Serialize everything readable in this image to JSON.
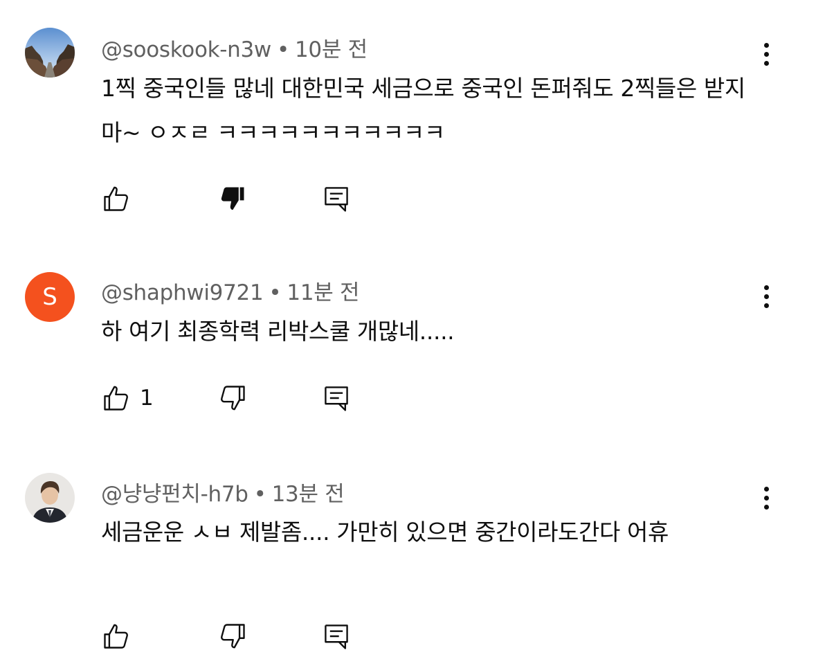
{
  "comments": [
    {
      "author": "@sooskook-n3w",
      "time": "10분 전",
      "text": "1찍 중국인들 많네 대한민국 세금으로 중국인 돈퍼줘도 2찍들은 받지마~ ㅇㅈㄹ ㅋㅋㅋㅋㅋㅋㅋㅋㅋㅋㅋ",
      "like_count": "",
      "disliked": true,
      "avatar_icon": "landscape-photo-avatar"
    },
    {
      "author": "@shaphwi9721",
      "time": "11분 전",
      "text": "하 여기 최종학력 리박스쿨 개많네.....",
      "like_count": "1",
      "disliked": false,
      "avatar_letter": "S",
      "avatar_color": "#f4511e"
    },
    {
      "author": "@냥냥펀치-h7b",
      "time": "13분 전",
      "text": "세금운운 ㅅㅂ 제발좀.... 가만히 있으면 중간이라도간다 어휴",
      "like_count": "",
      "disliked": false,
      "avatar_icon": "person-photo-avatar"
    }
  ],
  "separator": "•",
  "icons": {
    "like": "thumbs-up-icon",
    "dislike": "thumbs-down-icon",
    "reply": "reply-icon",
    "more": "more-vert-icon"
  }
}
